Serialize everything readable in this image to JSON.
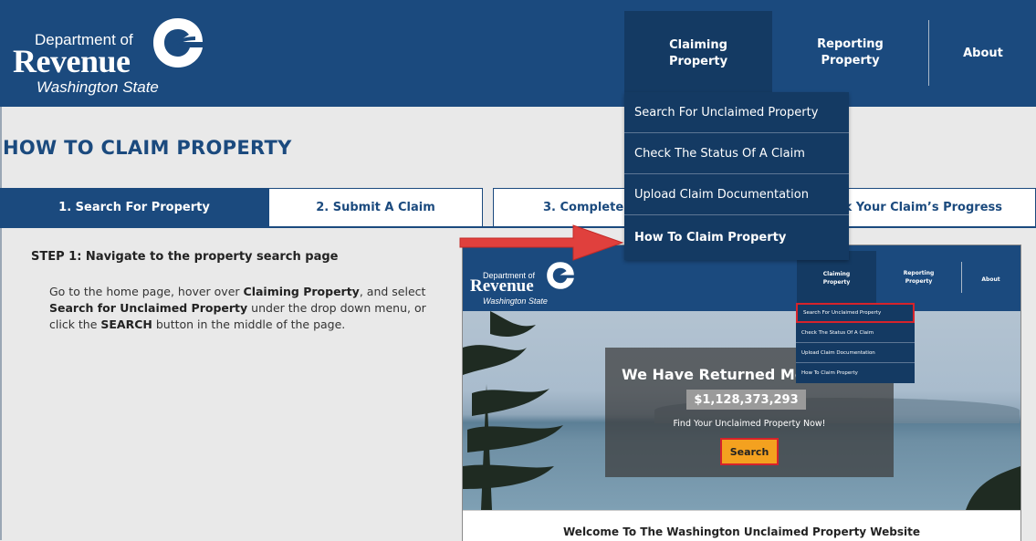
{
  "brand": {
    "line1": "Department of",
    "line2": "Revenue",
    "line3": "Washington State"
  },
  "nav": {
    "claiming": "Claiming\nProperty",
    "reporting": "Reporting\nProperty",
    "about": "About"
  },
  "dropdown": [
    "Search For Unclaimed Property",
    "Check The Status Of A Claim",
    "Upload Claim Documentation",
    "How To Claim Property"
  ],
  "page_title": "HOW TO CLAIM PROPERTY",
  "tabs": [
    "1. Search For Property",
    "2. Submit A Claim",
    "3. Complete",
    "ck Your Claim’s Progress"
  ],
  "step": {
    "title": "STEP 1: Navigate to the property search page",
    "text_1": "Go to the home page, hover over ",
    "bold_1": "Claiming Property",
    "text_2": ", and select ",
    "bold_2": "Search for Unclaimed Property",
    "text_3": " under the drop down menu, or click the ",
    "bold_3": "SEARCH",
    "text_4": " button in the middle of the page."
  },
  "embedded": {
    "nav_claiming": "Claiming\nProperty",
    "nav_reporting": "Reporting\nProperty",
    "nav_about": "About",
    "dropdown": [
      "Search For Unclaimed Property",
      "Check The Status Of A Claim",
      "Upload Claim Documentation",
      "How To Claim Property"
    ],
    "headline": "We Have Returned Mo",
    "amount": "$1,128,373,293",
    "subline": "Find Your Unclaimed Property Now!",
    "search_button": "Search",
    "footer": "Welcome To The Washington Unclaimed Property Website"
  },
  "colors": {
    "brand_blue": "#1b4a7e",
    "nav_active": "#143a63",
    "highlight_red": "#d6232b",
    "search_orange": "#f4a11f"
  }
}
